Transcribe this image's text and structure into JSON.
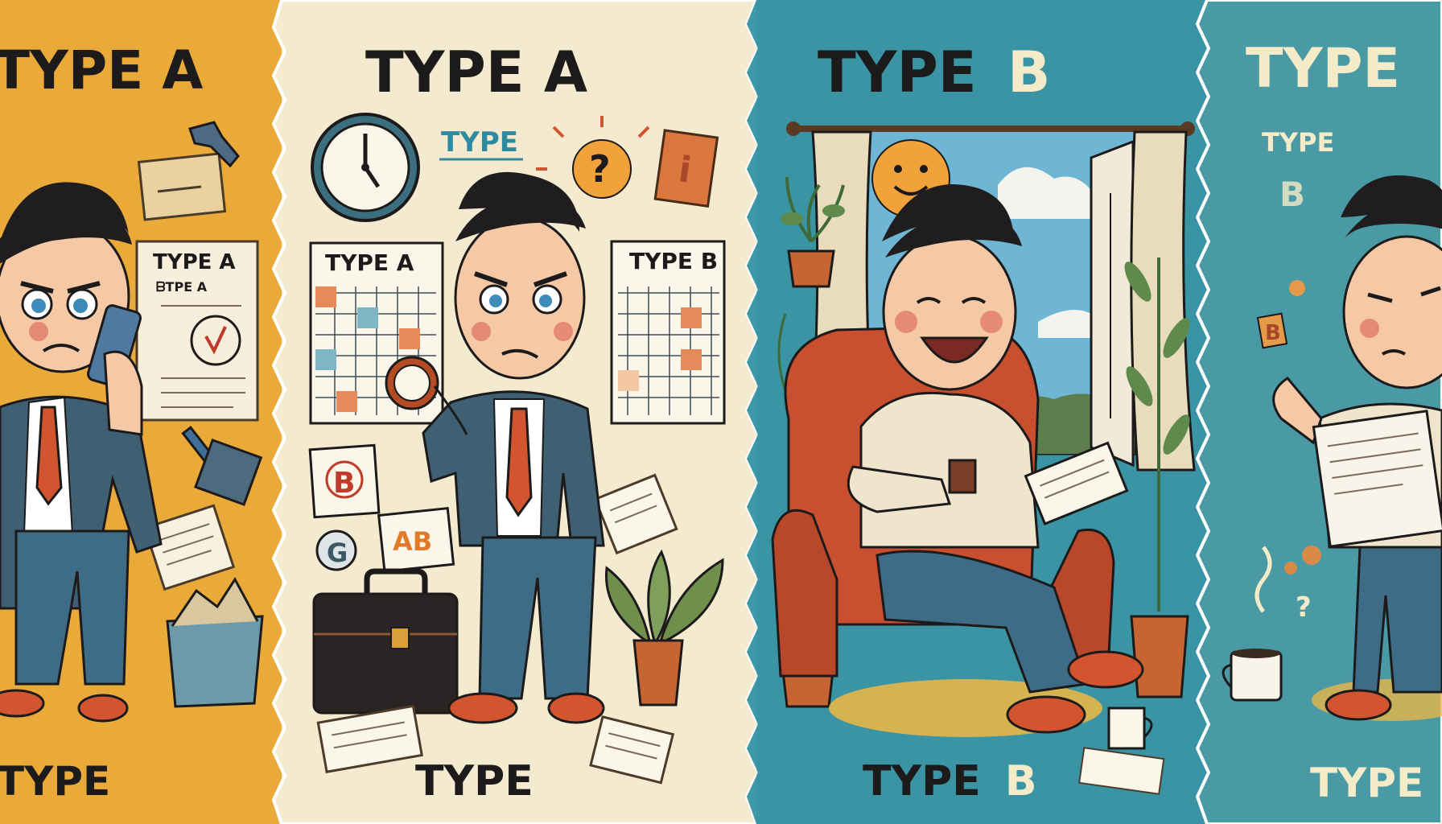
{
  "panels": [
    {
      "id": "panel-1",
      "title": "TYPE A",
      "poster_title": "TYPE A",
      "poster_subtitle": "ᗷTPE A",
      "footer": "TYPE",
      "background": "#e8a634"
    },
    {
      "id": "panel-2",
      "title": "TYPE A",
      "small_label": "TYPE",
      "question_mark": "?",
      "card_letter": "i",
      "calendar_left_title": "TYPE A",
      "calendar_right_title": "TYPE B",
      "note_b": "B",
      "note_g": "G",
      "note_ab": "AB",
      "footer": "TYPE",
      "background": "#f4ead0"
    },
    {
      "id": "panel-3",
      "title_part1": "TYPE",
      "title_part2": "B",
      "footer_part1": "TYPE",
      "footer_part2": "B",
      "background": "#3e9aa8"
    },
    {
      "id": "panel-4",
      "title": "TYPE",
      "small_label": "TYPE",
      "big_letter": "B",
      "tag_letter": "B",
      "question_mark": "?",
      "footer": "TYPE",
      "background": "#4a9aa6"
    }
  ],
  "colors": {
    "ink": "#1c1a1a",
    "cream_text": "#f4ecc8",
    "suit": "#3f5f72",
    "tie": "#d2552f",
    "skin": "#f6c9a6",
    "hair": "#1f1d1e",
    "armchair": "#c8502e",
    "plant": "#6f8f4c",
    "pot": "#c76532",
    "sun": "#f1a23a"
  }
}
